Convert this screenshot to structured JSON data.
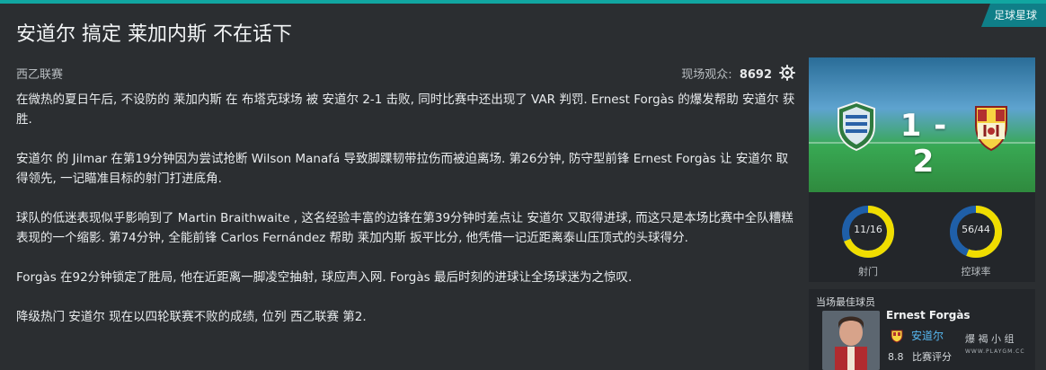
{
  "corner_tag": "足球星球",
  "headline": "安道尔 搞定 莱加内斯 不在话下",
  "competition": "西乙联赛",
  "attendance": {
    "label": "现场观众:",
    "value": "8692"
  },
  "report": [
    "在微热的夏日午后, 不设防的 莱加内斯 在 布塔克球场 被 安道尔 2-1 击败, 同时比赛中还出现了 VAR 判罚. Ernest Forgàs 的爆发帮助 安道尔 获胜.",
    "安道尔 的 Jilmar 在第19分钟因为尝试抢断 Wilson Manafá 导致脚踝韧带拉伤而被迫离场. 第26分钟, 防守型前锋 Ernest Forgàs 让 安道尔 取得领先, 一记瞄准目标的射门打进底角.",
    "球队的低迷表现似乎影响到了 Martin Braithwaite , 这名经验丰富的边锋在第39分钟时差点让 安道尔 又取得进球, 而这只是本场比赛中全队糟糕表现的一个缩影. 第74分钟, 全能前锋 Carlos Fernández 帮助 莱加内斯 扳平比分, 他凭借一记近距离泰山压顶式的头球得分.",
    "Forgàs 在92分钟锁定了胜局, 他在近距离一脚凌空抽射, 球应声入网. Forgàs 最后时刻的进球让全场球迷为之惊叹.",
    "降级热门 安道尔 现在以四轮联赛不败的成绩, 位列 西乙联赛 第2."
  ],
  "scoreboard": {
    "score": "1 - 2",
    "home_crest_icon": "leganes-crest-icon",
    "away_crest_icon": "andorra-crest-icon"
  },
  "stats": [
    {
      "value": "11/16",
      "label": "射门",
      "fraction": 0.6875,
      "color_a": "#f0dd00",
      "color_b": "#1f5fa8"
    },
    {
      "value": "56/44",
      "label": "控球率",
      "fraction": 0.56,
      "color_a": "#f0dd00",
      "color_b": "#1f5fa8"
    }
  ],
  "best_player": {
    "section_title": "当场最佳球员",
    "name": "Ernest Forgàs",
    "club": "安道尔",
    "rating_value": "8.8",
    "rating_label": "比赛评分"
  },
  "watermark": {
    "line1": "爆 褐 小 组",
    "line2": "WWW.PLAYGM.CC"
  },
  "colors": {
    "accent": "#11a6a1",
    "tag_bg": "#0f7f88",
    "stat_yellow": "#f0dd00",
    "stat_blue": "#1f5fa8"
  }
}
